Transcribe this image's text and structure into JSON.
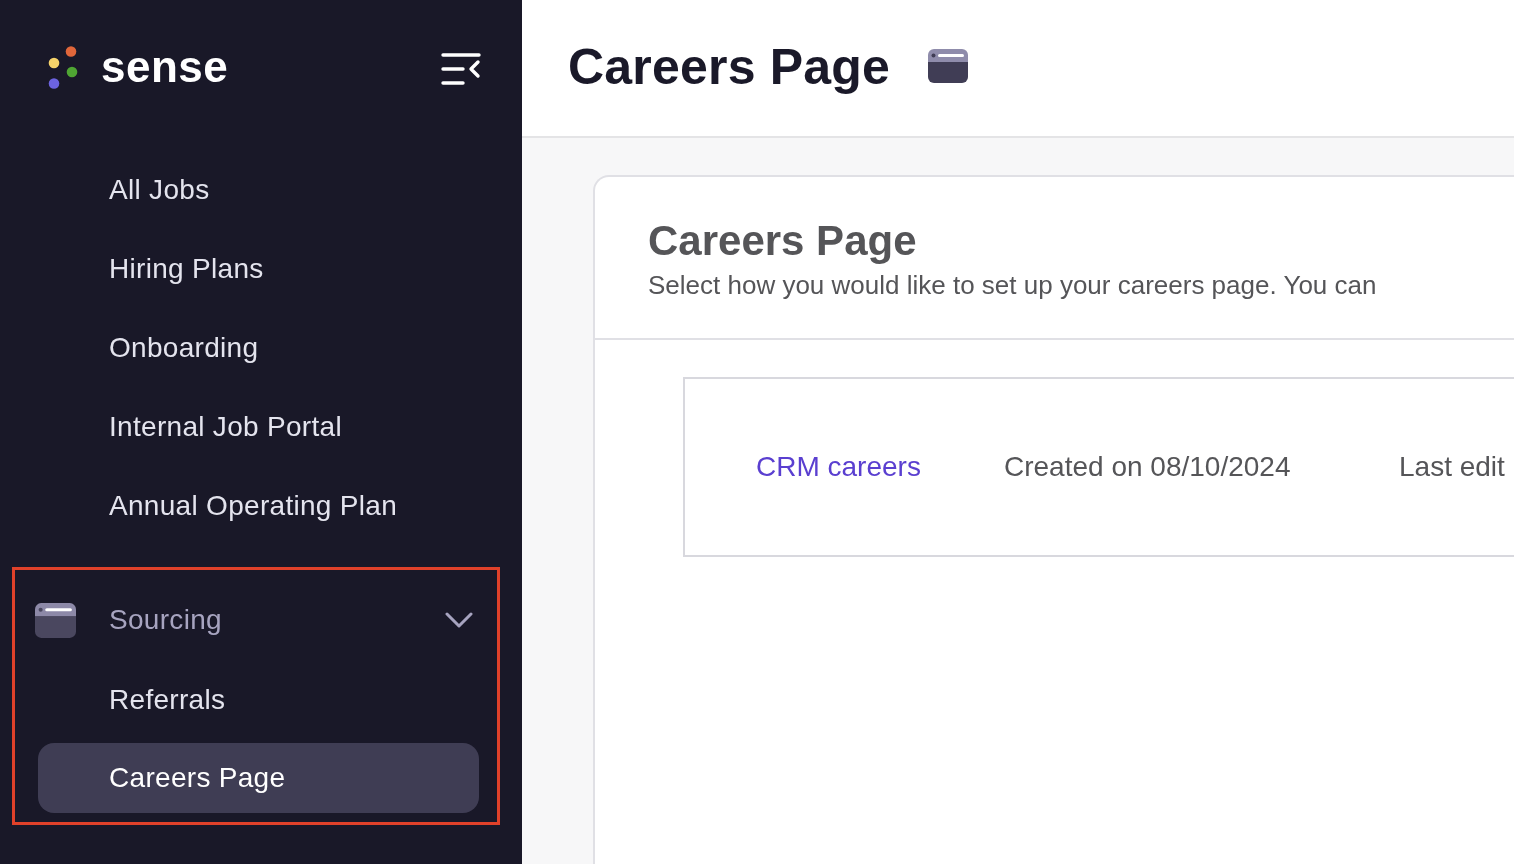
{
  "sidebar": {
    "logo": {
      "text": "sense"
    },
    "nav_items": [
      {
        "label": "All Jobs",
        "selected": false
      },
      {
        "label": "Hiring Plans",
        "selected": false
      },
      {
        "label": "Onboarding",
        "selected": false
      },
      {
        "label": "Internal Job Portal",
        "selected": false
      },
      {
        "label": "Annual Operating Plan",
        "selected": false
      }
    ],
    "groups": [
      {
        "label": "Sourcing",
        "expanded": true,
        "highlighted": true,
        "children": [
          {
            "label": "Referrals",
            "selected": false
          },
          {
            "label": "Careers Page",
            "selected": true
          }
        ]
      }
    ]
  },
  "header": {
    "title": "Careers Page"
  },
  "card": {
    "title": "Careers Page",
    "description": "Select how you would like to set up your careers page. You can",
    "pages": [
      {
        "name": "CRM careers",
        "created": "Created on 08/10/2024",
        "column_3": "Last edit"
      }
    ]
  }
}
